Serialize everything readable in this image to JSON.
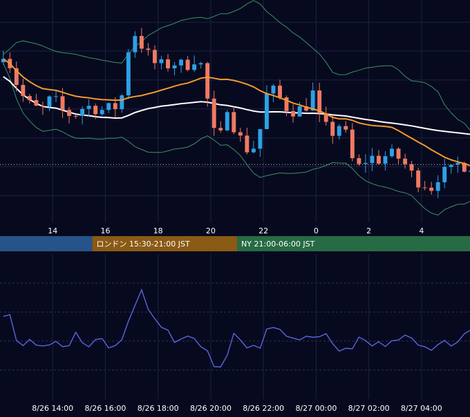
{
  "colors": {
    "background": "#070a1f",
    "grid": "#1c2240",
    "candle_up": "#2ea0e6",
    "candle_down": "#f07a63",
    "sma_fast": "#f59a2c",
    "sma_slow": "#ffffff",
    "bollinger": "#3f8f66",
    "rsi_line": "#5c64e0",
    "axis_text": "#ffffff",
    "session_tokyo": "#26548a",
    "session_london": "#8a5a15",
    "session_ny": "#276b44"
  },
  "sessions": [
    {
      "label": "",
      "color": "#26548a",
      "start_hour": 12.0,
      "end_hour": 15.5
    },
    {
      "label": "ロンドン 15:30-21:00 JST",
      "color": "#8a5a15",
      "start_hour": 15.5,
      "end_hour": 21.0
    },
    {
      "label": "NY 21:00-06:00 JST",
      "color": "#276b44",
      "start_hour": 21.0,
      "end_hour": 30.0
    }
  ],
  "chart_data": [
    {
      "type": "candlestick",
      "name": "price",
      "x_start_hour": 12.0,
      "x_end_hour": 29.84,
      "x_tick_labels": [
        "14",
        "16",
        "18",
        "20",
        "22",
        "0",
        "2",
        "4"
      ],
      "x_tick_hours": [
        14,
        16,
        18,
        20,
        22,
        24,
        26,
        28
      ],
      "y_range": [
        0,
        100
      ],
      "reference_line": 26,
      "waypoints": [
        [
          12.0,
          72
        ],
        [
          12.3,
          78
        ],
        [
          12.6,
          68
        ],
        [
          12.9,
          58
        ],
        [
          13.3,
          52
        ],
        [
          13.7,
          50
        ],
        [
          14.1,
          56
        ],
        [
          14.5,
          50
        ],
        [
          14.9,
          48
        ],
        [
          15.3,
          52
        ],
        [
          15.7,
          52
        ],
        [
          16.1,
          50
        ],
        [
          16.5,
          52
        ],
        [
          16.8,
          58
        ],
        [
          17.0,
          78
        ],
        [
          17.2,
          86
        ],
        [
          17.5,
          80
        ],
        [
          17.9,
          72
        ],
        [
          18.3,
          70
        ],
        [
          18.7,
          72
        ],
        [
          19.1,
          70
        ],
        [
          19.5,
          74
        ],
        [
          19.8,
          70
        ],
        [
          20.0,
          55
        ],
        [
          20.2,
          40
        ],
        [
          20.6,
          38
        ],
        [
          20.8,
          58
        ],
        [
          21.0,
          44
        ],
        [
          21.3,
          36
        ],
        [
          21.6,
          32
        ],
        [
          21.9,
          36
        ],
        [
          22.1,
          48
        ],
        [
          22.3,
          60
        ],
        [
          22.6,
          58
        ],
        [
          23.0,
          52
        ],
        [
          23.4,
          50
        ],
        [
          23.7,
          52
        ],
        [
          24.0,
          58
        ],
        [
          24.3,
          44
        ],
        [
          24.7,
          40
        ],
        [
          25.0,
          44
        ],
        [
          25.3,
          38
        ],
        [
          25.5,
          28
        ],
        [
          25.8,
          24
        ],
        [
          26.1,
          30
        ],
        [
          26.4,
          28
        ],
        [
          26.8,
          30
        ],
        [
          27.2,
          30
        ],
        [
          27.4,
          26
        ],
        [
          27.6,
          26
        ],
        [
          27.8,
          20
        ],
        [
          28.2,
          18
        ],
        [
          28.5,
          16
        ],
        [
          28.8,
          22
        ],
        [
          29.2,
          22
        ],
        [
          29.5,
          26
        ],
        [
          29.84,
          26
        ]
      ]
    },
    {
      "type": "line",
      "name": "oscillator",
      "x_tick_labels": [
        "8/26 14:00",
        "8/26 16:00",
        "8/26 18:00",
        "8/26 20:00",
        "8/26 22:00",
        "8/27 00:00",
        "8/27 02:00",
        "8/27 04:00"
      ],
      "x_tick_hours": [
        14,
        16,
        18,
        20,
        22,
        24,
        26,
        28
      ],
      "y_range": [
        0,
        100
      ],
      "levels": [
        80,
        60,
        40,
        20
      ],
      "waypoints": [
        [
          12.0,
          60
        ],
        [
          12.15,
          65
        ],
        [
          12.35,
          52
        ],
        [
          12.55,
          38
        ],
        [
          12.8,
          40
        ],
        [
          13.2,
          38
        ],
        [
          13.6,
          36
        ],
        [
          14.0,
          40
        ],
        [
          14.4,
          36
        ],
        [
          14.8,
          46
        ],
        [
          15.2,
          36
        ],
        [
          15.6,
          42
        ],
        [
          16.0,
          36
        ],
        [
          16.3,
          40
        ],
        [
          16.6,
          44
        ],
        [
          16.8,
          55
        ],
        [
          17.0,
          64
        ],
        [
          17.25,
          75
        ],
        [
          17.5,
          62
        ],
        [
          17.8,
          56
        ],
        [
          18.1,
          48
        ],
        [
          18.5,
          42
        ],
        [
          18.9,
          44
        ],
        [
          19.3,
          40
        ],
        [
          19.7,
          38
        ],
        [
          19.9,
          22
        ],
        [
          20.1,
          18
        ],
        [
          20.4,
          26
        ],
        [
          20.7,
          46
        ],
        [
          21.0,
          38
        ],
        [
          21.3,
          36
        ],
        [
          21.6,
          34
        ],
        [
          21.9,
          42
        ],
        [
          22.1,
          52
        ],
        [
          22.3,
          46
        ],
        [
          22.6,
          45
        ],
        [
          23.0,
          44
        ],
        [
          23.3,
          38
        ],
        [
          23.6,
          42
        ],
        [
          24.0,
          40
        ],
        [
          24.3,
          44
        ],
        [
          24.6,
          36
        ],
        [
          24.9,
          33
        ],
        [
          25.2,
          37
        ],
        [
          25.5,
          40
        ],
        [
          25.8,
          38
        ],
        [
          26.2,
          37
        ],
        [
          26.6,
          40
        ],
        [
          27.0,
          38
        ],
        [
          27.3,
          45
        ],
        [
          27.6,
          39
        ],
        [
          28.0,
          34
        ],
        [
          28.4,
          34
        ],
        [
          28.8,
          38
        ],
        [
          29.2,
          36
        ],
        [
          29.4,
          42
        ],
        [
          29.6,
          48
        ],
        [
          29.84,
          50
        ]
      ]
    }
  ]
}
